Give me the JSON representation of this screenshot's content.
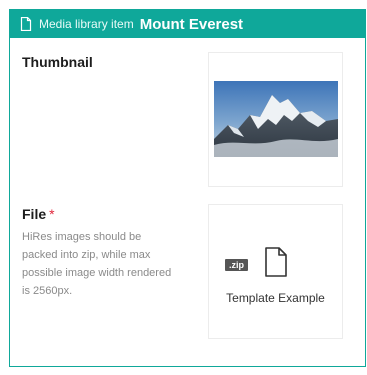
{
  "header": {
    "kind": "Media library item",
    "title": "Mount Everest",
    "icon": "document-icon",
    "color": "#0fa89a"
  },
  "thumbnail": {
    "label": "Thumbnail"
  },
  "file": {
    "label": "File",
    "required_marker": "*",
    "help": "HiRes images should be packed into zip, while max possible image width rendered is 2560px.",
    "badge": ".zip",
    "name": "Template Example"
  }
}
